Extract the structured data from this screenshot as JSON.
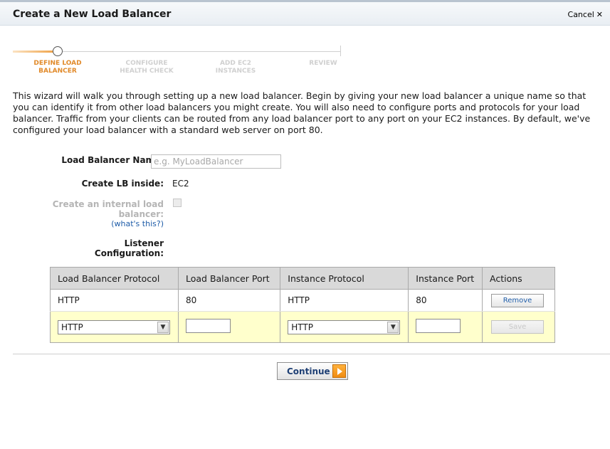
{
  "dialog": {
    "title": "Create a New Load Balancer",
    "cancel_label": "Cancel",
    "cancel_icon": "close-x"
  },
  "wizard": {
    "steps": [
      {
        "line1": "DEFINE LOAD",
        "line2": "BALANCER",
        "active": true
      },
      {
        "line1": "CONFIGURE",
        "line2": "HEALTH CHECK",
        "active": false
      },
      {
        "line1": "ADD EC2",
        "line2": "INSTANCES",
        "active": false
      },
      {
        "line1": "REVIEW",
        "line2": "",
        "active": false
      }
    ]
  },
  "intro": "This wizard will walk you through setting up a new load balancer. Begin by giving your new load balancer a unique name so that you can identify it from other load balancers you might create. You will also need to configure ports and protocols for your load balancer. Traffic from your clients can be routed from any load balancer port to any port on your EC2 instances. By default, we've configured your load balancer with a standard web server on port 80.",
  "form": {
    "name_label": "Load Balancer Name:",
    "name_placeholder": "e.g. MyLoadBalancer",
    "name_value": "",
    "inside_label": "Create LB inside:",
    "inside_value": "EC2",
    "internal_label_line1": "Create an internal load",
    "internal_label_line2": "balancer:",
    "internal_help": "(what's this?)",
    "internal_checked": false,
    "listener_label_line1": "Listener",
    "listener_label_line2": "Configuration:"
  },
  "listeners": {
    "headers": [
      "Load Balancer Protocol",
      "Load Balancer Port",
      "Instance Protocol",
      "Instance Port",
      "Actions"
    ],
    "rows": [
      {
        "lb_protocol": "HTTP",
        "lb_port": "80",
        "instance_protocol": "HTTP",
        "instance_port": "80",
        "action": "Remove"
      }
    ],
    "new_row": {
      "lb_protocol": "HTTP",
      "lb_port": "",
      "instance_protocol": "HTTP",
      "instance_port": "",
      "action": "Save"
    }
  },
  "footer": {
    "continue_label": "Continue"
  },
  "colors": {
    "active_step": "#e18a2a",
    "new_row_bg": "#ffffcc",
    "link": "#1e5ca8"
  }
}
